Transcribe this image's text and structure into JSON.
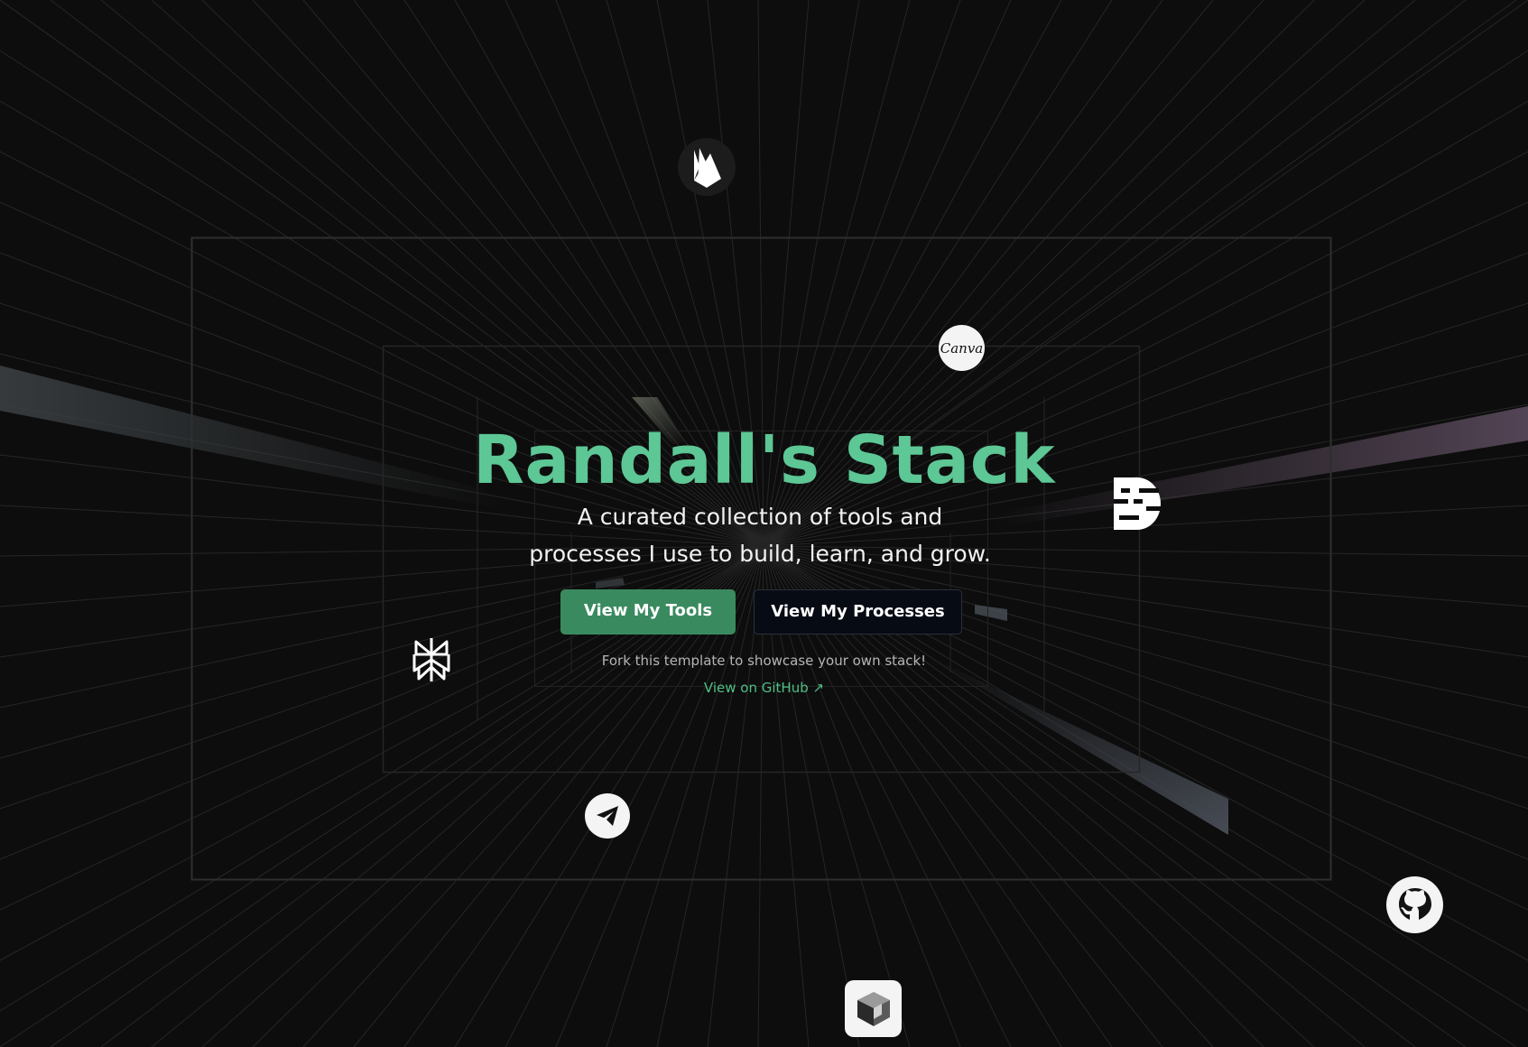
{
  "hero": {
    "title": "Randall's Stack",
    "subtitle": "A curated collection of tools and processes I use to build, learn, and grow.",
    "primary_button": "View My Tools",
    "secondary_button": "View My Processes",
    "fork_note": "Fork this template to showcase your own stack!",
    "github_link": "View on GitHub ↗"
  },
  "floating_logos": {
    "firebase": "firebase-logo",
    "canva": "Canva",
    "deepseek": "deepseek-logo",
    "perplexity": "perplexity-logo",
    "telegram": "telegram-logo",
    "github": "github-logo",
    "cube": "cube-logo"
  },
  "colors": {
    "background": "#0d0d0d",
    "title": "#5dc795",
    "primary_button": "#3a8a5f",
    "secondary_button": "#070b14",
    "link": "#4fbf85",
    "grid_line": "#2a2a2a",
    "frame": "#2e2e2e"
  }
}
